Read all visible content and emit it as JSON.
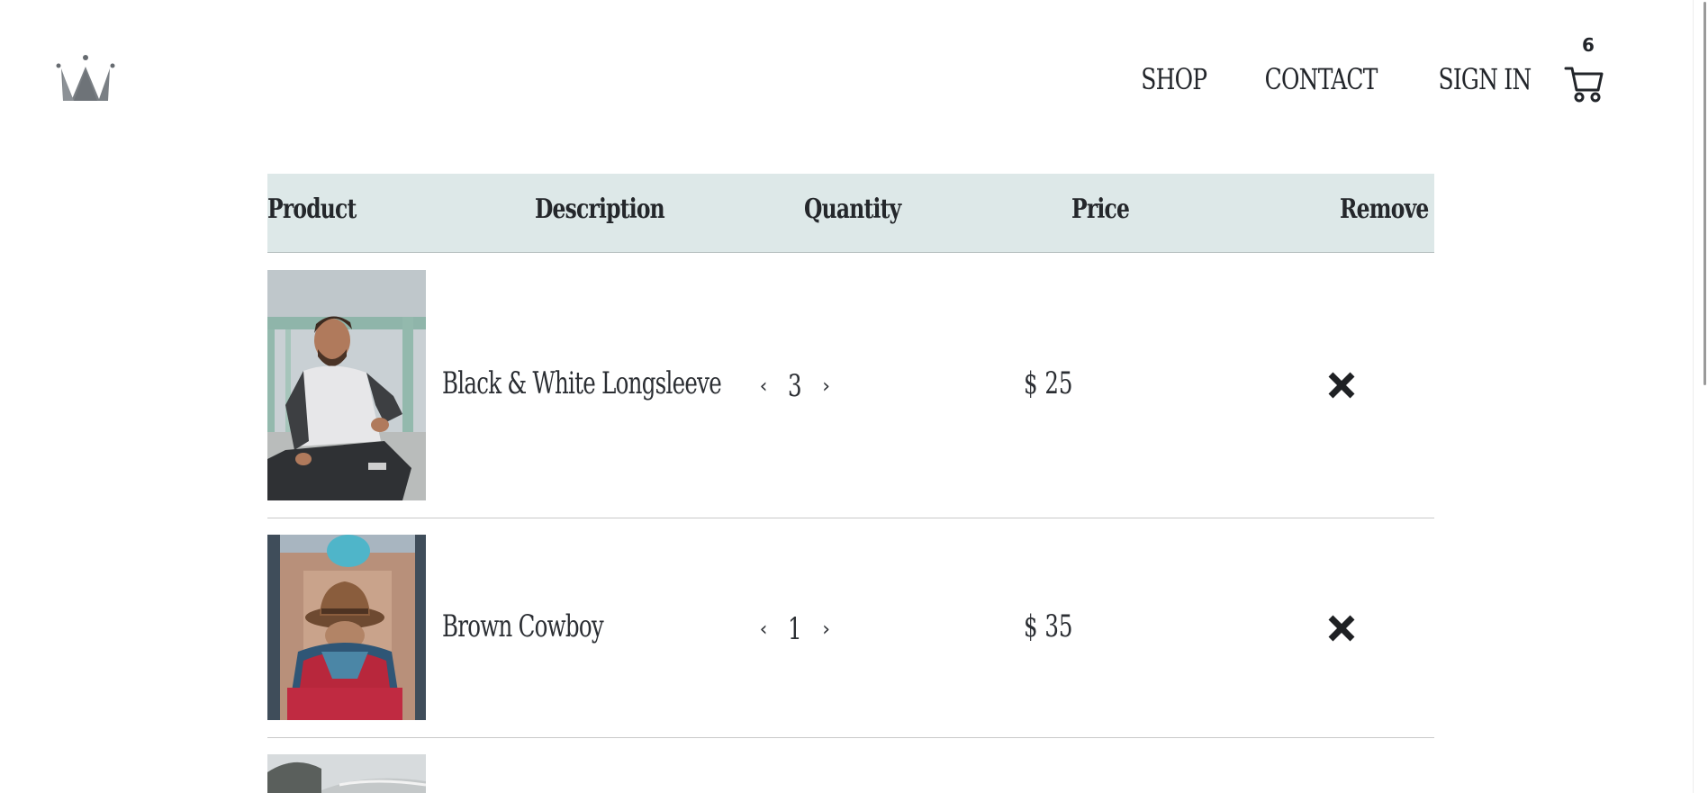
{
  "nav": {
    "items": [
      {
        "label": "SHOP"
      },
      {
        "label": "CONTACT"
      },
      {
        "label": "SIGN IN"
      }
    ],
    "cart_count": "6",
    "cart_icon": "shopping-cart-icon",
    "logo_icon": "crown-icon"
  },
  "table": {
    "headers": [
      "Product",
      "Description",
      "Quantity",
      "Price",
      "Remove"
    ],
    "header_bg": "#dde8e8",
    "rows": [
      {
        "description": "Black & White Longsleeve",
        "quantity": "3",
        "price": "$ 25",
        "prev": "‹",
        "next": "›"
      },
      {
        "description": "Brown Cowboy",
        "quantity": "1",
        "price": "$ 35",
        "prev": "‹",
        "next": "›"
      },
      {
        "description": "",
        "quantity": "",
        "price": ""
      }
    ]
  }
}
